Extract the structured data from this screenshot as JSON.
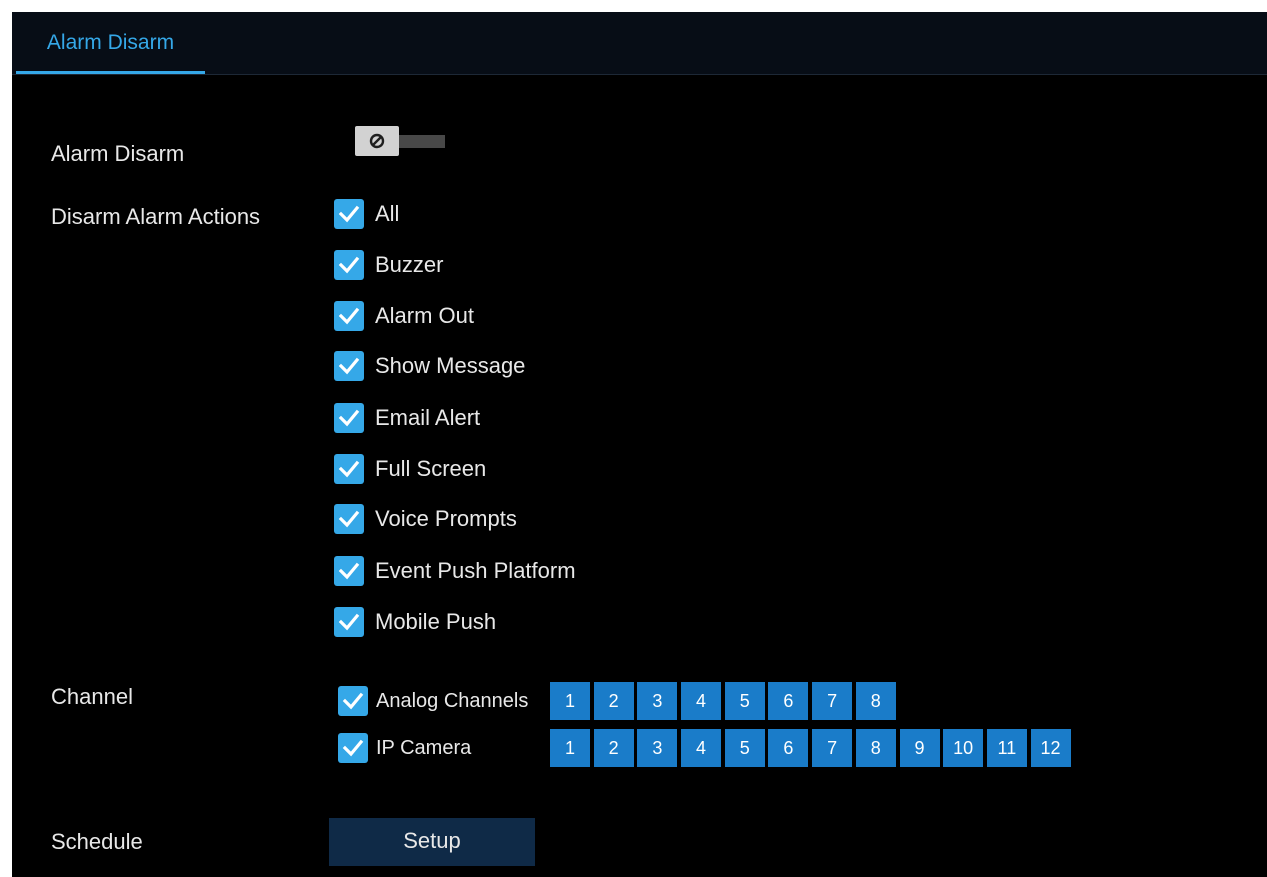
{
  "colors": {
    "accent": "#35a8e8",
    "channel_button": "#1a7cc9",
    "background": "#000000",
    "setup_button": "#0f2a47"
  },
  "tab": {
    "label": "Alarm Disarm"
  },
  "alarm_disarm": {
    "label": "Alarm Disarm",
    "toggle_state": "off",
    "toggle_icon": "disabled-circle-icon"
  },
  "actions": {
    "label": "Disarm Alarm Actions",
    "items": [
      {
        "label": "All",
        "checked": true
      },
      {
        "label": "Buzzer",
        "checked": true
      },
      {
        "label": "Alarm Out",
        "checked": true
      },
      {
        "label": "Show Message",
        "checked": true
      },
      {
        "label": "Email Alert",
        "checked": true
      },
      {
        "label": "Full Screen",
        "checked": true
      },
      {
        "label": "Voice Prompts",
        "checked": true
      },
      {
        "label": "Event Push Platform",
        "checked": true
      },
      {
        "label": "Mobile Push",
        "checked": true
      }
    ]
  },
  "channel": {
    "label": "Channel",
    "analog": {
      "label": "Analog Channels",
      "checked": true,
      "channels": [
        "1",
        "2",
        "3",
        "4",
        "5",
        "6",
        "7",
        "8"
      ]
    },
    "ip": {
      "label": "IP Camera",
      "checked": true,
      "channels": [
        "1",
        "2",
        "3",
        "4",
        "5",
        "6",
        "7",
        "8",
        "9",
        "10",
        "11",
        "12"
      ]
    }
  },
  "schedule": {
    "label": "Schedule",
    "button_label": "Setup"
  }
}
